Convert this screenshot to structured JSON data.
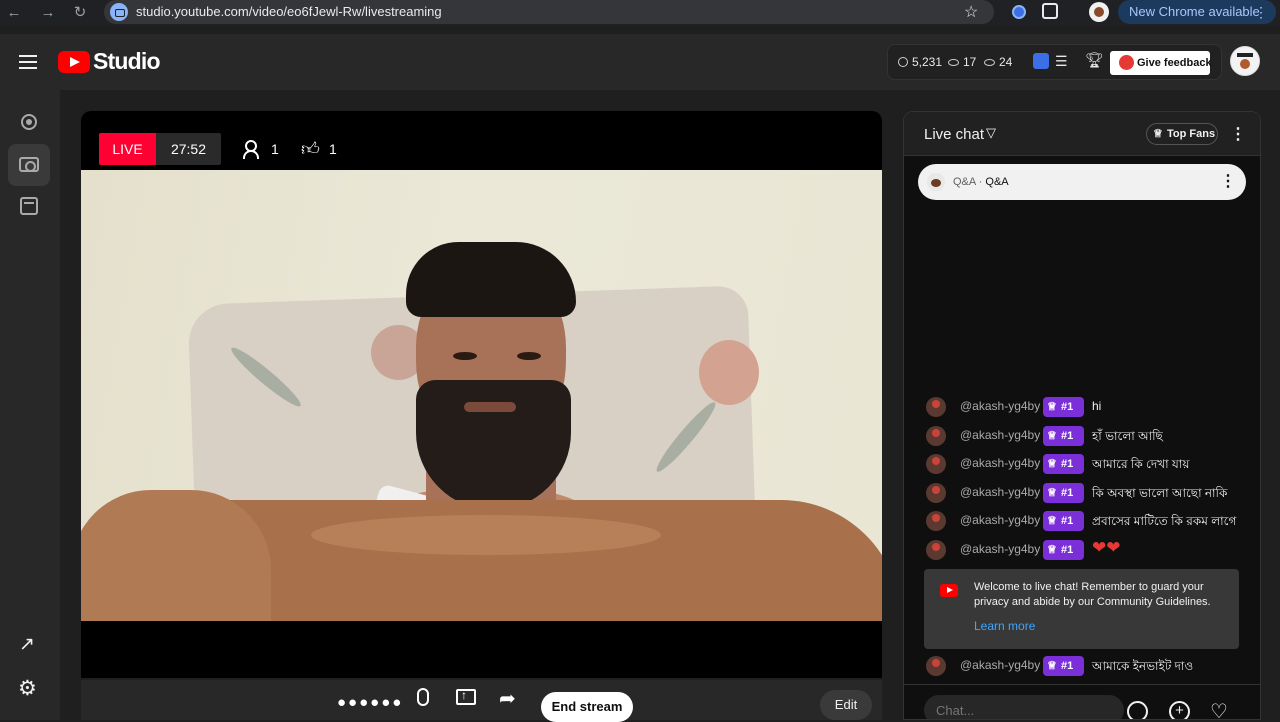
{
  "browser": {
    "url": "studio.youtube.com/video/eo6fJewl-Rw/livestreaming",
    "update_label": "New Chrome available",
    "update_menu_glyph": "⋮"
  },
  "header": {
    "app_name": "Studio",
    "stats": {
      "subscribers": "5,231",
      "views": "17",
      "watching": "24"
    },
    "feedback_label": "Give feedback"
  },
  "stream": {
    "live_label": "LIVE",
    "elapsed": "27:52",
    "viewers": "1",
    "likes": "1"
  },
  "controls": {
    "end_stream_label": "End stream",
    "edit_label": "Edit"
  },
  "chat": {
    "title": "Live chat",
    "top_fans_label": "Top Fans",
    "qa_prefix": "Q&A · ",
    "qa_label": "Q&A",
    "messages": [
      {
        "author": "@akash-yg4by",
        "badge": "#1",
        "text": "hi"
      },
      {
        "author": "@akash-yg4by",
        "badge": "#1",
        "text": "হাঁ ভালো আছি"
      },
      {
        "author": "@akash-yg4by",
        "badge": "#1",
        "text": "আমারে কি দেখা যায়"
      },
      {
        "author": "@akash-yg4by",
        "badge": "#1",
        "text": "কি অবস্থা ভালো আছো নাকি"
      },
      {
        "author": "@akash-yg4by",
        "badge": "#1",
        "text": "প্রবাসের মাটিতে কি রকম লাগে"
      },
      {
        "author": "@akash-yg4by",
        "badge": "#1",
        "text": "❤❤"
      },
      {
        "author": "@akash-yg4by",
        "badge": "#1",
        "text": "আমাকে ইনভাইট দাও"
      }
    ],
    "welcome_text": "Welcome to live chat! Remember to guard your privacy and abide by our Community Guidelines.",
    "learn_more_label": "Learn more",
    "input_placeholder": "Chat..."
  },
  "colors": {
    "accent_live": "#ff0033",
    "badge_purple": "#7b2fd8",
    "link_blue": "#3ea6ff"
  }
}
